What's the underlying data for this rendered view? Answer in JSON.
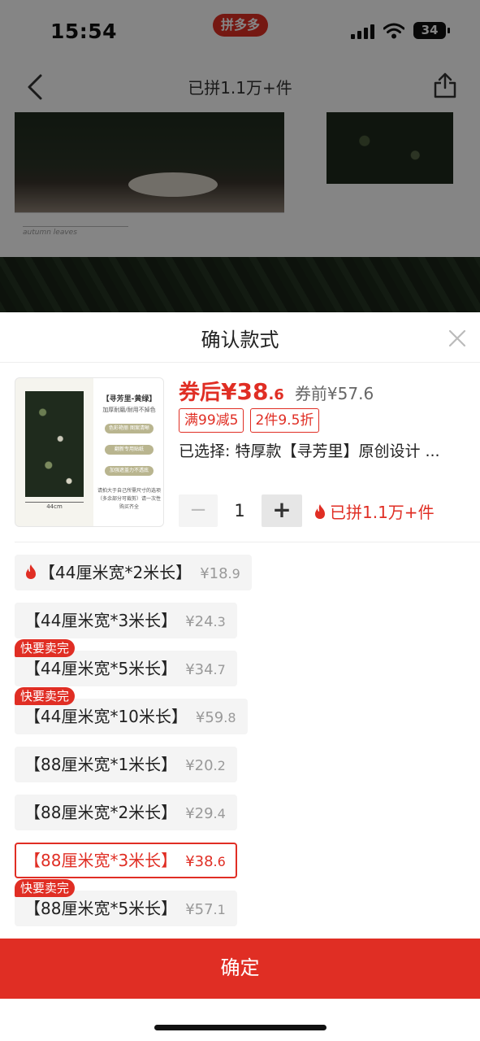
{
  "status_bar": {
    "time": "15:54",
    "battery": "34",
    "brand": "拼多多"
  },
  "nav": {
    "title": "已拼1.1万+件"
  },
  "background": {
    "image_caption": "autumn leaves"
  },
  "sheet": {
    "title": "确认款式",
    "product": {
      "thumb_title": "【寻芳里-黄绿】",
      "thumb_subtitle": "加厚耐磨/耐用不掉色",
      "thumb_tags": [
        "色彩艳丽 图案清晰",
        "翻新专用贴纸",
        "加强遮盖力不透底"
      ],
      "thumb_note": "请拍大于自己所需尺寸的选项（多余部分可裁剪）请一次性购买齐全",
      "thumb_dimension": "44cm",
      "price_prefix": "券后",
      "price_int": "¥38",
      "price_dec": ".6",
      "price_before": "券前¥57.6",
      "coupons": [
        "满99减5",
        "2件9.5折"
      ],
      "selected": "已选择: 特厚款【寻芳里】原创设计 ..."
    },
    "quantity": {
      "minus": "−",
      "value": "1",
      "plus": "+"
    },
    "sold_info": "已拼1.1万+件",
    "options": [
      {
        "label": "【44厘米宽*2米长】",
        "price_int": "¥18",
        "price_dec": ".9",
        "hot": true,
        "badge": "",
        "selected": false
      },
      {
        "label": "【44厘米宽*3米长】",
        "price_int": "¥24",
        "price_dec": ".3",
        "hot": false,
        "badge": "",
        "selected": false
      },
      {
        "label": "【44厘米宽*5米长】",
        "price_int": "¥34",
        "price_dec": ".7",
        "hot": false,
        "badge": "快要卖完",
        "selected": false
      },
      {
        "label": "【44厘米宽*10米长】",
        "price_int": "¥59",
        "price_dec": ".8",
        "hot": false,
        "badge": "快要卖完",
        "selected": false
      },
      {
        "label": "【88厘米宽*1米长】",
        "price_int": "¥20",
        "price_dec": ".2",
        "hot": false,
        "badge": "",
        "selected": false
      },
      {
        "label": "【88厘米宽*2米长】",
        "price_int": "¥29",
        "price_dec": ".4",
        "hot": false,
        "badge": "",
        "selected": false
      },
      {
        "label": "【88厘米宽*3米长】",
        "price_int": "¥38",
        "price_dec": ".6",
        "hot": false,
        "badge": "",
        "selected": true
      },
      {
        "label": "【88厘米宽*5米长】",
        "price_int": "¥57",
        "price_dec": ".1",
        "hot": false,
        "badge": "快要卖完",
        "selected": false
      }
    ],
    "confirm_label": "确定"
  },
  "colors": {
    "accent": "#e02e24",
    "option_bg": "#f4f4f4",
    "muted": "#999999"
  }
}
